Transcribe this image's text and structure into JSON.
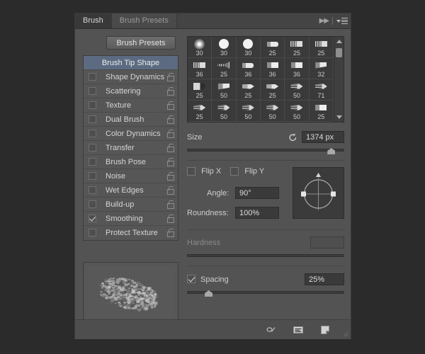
{
  "panel": {
    "tabs": [
      {
        "label": "Brush",
        "active": true
      },
      {
        "label": "Brush Presets",
        "active": false
      }
    ],
    "collapse_icon": "double-chevron-right-icon",
    "menu_icon": "panel-menu-icon"
  },
  "presets_button": {
    "label": "Brush Presets"
  },
  "options_list": [
    {
      "label": "Brush Tip Shape",
      "selected": true,
      "checkbox": false,
      "checked": false,
      "lock": false
    },
    {
      "label": "Shape Dynamics",
      "selected": false,
      "checkbox": true,
      "checked": false,
      "lock": true
    },
    {
      "label": "Scattering",
      "selected": false,
      "checkbox": true,
      "checked": false,
      "lock": true
    },
    {
      "label": "Texture",
      "selected": false,
      "checkbox": true,
      "checked": false,
      "lock": true
    },
    {
      "label": "Dual Brush",
      "selected": false,
      "checkbox": true,
      "checked": false,
      "lock": true
    },
    {
      "label": "Color Dynamics",
      "selected": false,
      "checkbox": true,
      "checked": false,
      "lock": true
    },
    {
      "label": "Transfer",
      "selected": false,
      "checkbox": true,
      "checked": false,
      "lock": true
    },
    {
      "label": "Brush Pose",
      "selected": false,
      "checkbox": true,
      "checked": false,
      "lock": true
    },
    {
      "label": "Noise",
      "selected": false,
      "checkbox": true,
      "checked": false,
      "lock": true
    },
    {
      "label": "Wet Edges",
      "selected": false,
      "checkbox": true,
      "checked": false,
      "lock": true
    },
    {
      "label": "Build-up",
      "selected": false,
      "checkbox": true,
      "checked": false,
      "lock": true
    },
    {
      "label": "Smoothing",
      "selected": false,
      "checkbox": true,
      "checked": true,
      "lock": true
    },
    {
      "label": "Protect Texture",
      "selected": false,
      "checkbox": true,
      "checked": false,
      "lock": true
    }
  ],
  "brush_grid": {
    "scrollbar": {
      "up_icon": "scroll-up-arrow-icon",
      "down_icon": "scroll-down-arrow-icon"
    },
    "tips": [
      {
        "size": "30",
        "shape": "soft-round"
      },
      {
        "size": "30",
        "shape": "hard-round"
      },
      {
        "size": "30",
        "shape": "hard-round"
      },
      {
        "size": "25",
        "shape": "flat-tip"
      },
      {
        "size": "25",
        "shape": "bristle"
      },
      {
        "size": "25",
        "shape": "bristle"
      },
      {
        "size": "36",
        "shape": "bristle"
      },
      {
        "size": "25",
        "shape": "fan"
      },
      {
        "size": "36",
        "shape": "flat-tip"
      },
      {
        "size": "36",
        "shape": "square-tip"
      },
      {
        "size": "36",
        "shape": "square-tip"
      },
      {
        "size": "32",
        "shape": "angled-tip"
      },
      {
        "size": "25",
        "shape": "round-fan"
      },
      {
        "size": "50",
        "shape": "angled-tip"
      },
      {
        "size": "25",
        "shape": "taper-tip"
      },
      {
        "size": "25",
        "shape": "taper-tip"
      },
      {
        "size": "50",
        "shape": "thin-taper"
      },
      {
        "size": "71",
        "shape": "thin-taper"
      },
      {
        "size": "25",
        "shape": "thin-taper"
      },
      {
        "size": "50",
        "shape": "thin-taper"
      },
      {
        "size": "50",
        "shape": "thin-taper"
      },
      {
        "size": "50",
        "shape": "thin-taper"
      },
      {
        "size": "50",
        "shape": "thin-taper"
      },
      {
        "size": "25",
        "shape": "square-tip"
      }
    ]
  },
  "size": {
    "label": "Size",
    "reset_icon": "reset-arrow-icon",
    "value": "1374 px",
    "slider_percent": 92
  },
  "flip": {
    "x_label": "Flip X",
    "x_checked": false,
    "y_label": "Flip Y",
    "y_checked": false
  },
  "angle": {
    "label": "Angle:",
    "value": "90°"
  },
  "roundness": {
    "label": "Roundness:",
    "value": "100%"
  },
  "angle_control": {
    "icon": "angle-roundness-dial"
  },
  "hardness": {
    "label": "Hardness",
    "value": "",
    "disabled": true,
    "slider_percent": 0
  },
  "spacing": {
    "label": "Spacing",
    "checked": true,
    "value": "25%",
    "slider_percent": 14
  },
  "preview": {
    "name": "brush-stroke-preview"
  },
  "bottom_bar": {
    "icons": [
      {
        "name": "toggle-brush-settings-icon"
      },
      {
        "name": "brush-preview-toggle-icon"
      },
      {
        "name": "create-new-brush-icon"
      }
    ],
    "resize_grip": "resize-grip"
  },
  "colors": {
    "panel_bg": "#535353",
    "selection_blue": "#5c6b81",
    "field_bg": "#3a3a3a",
    "text": "#d5d5d5"
  }
}
